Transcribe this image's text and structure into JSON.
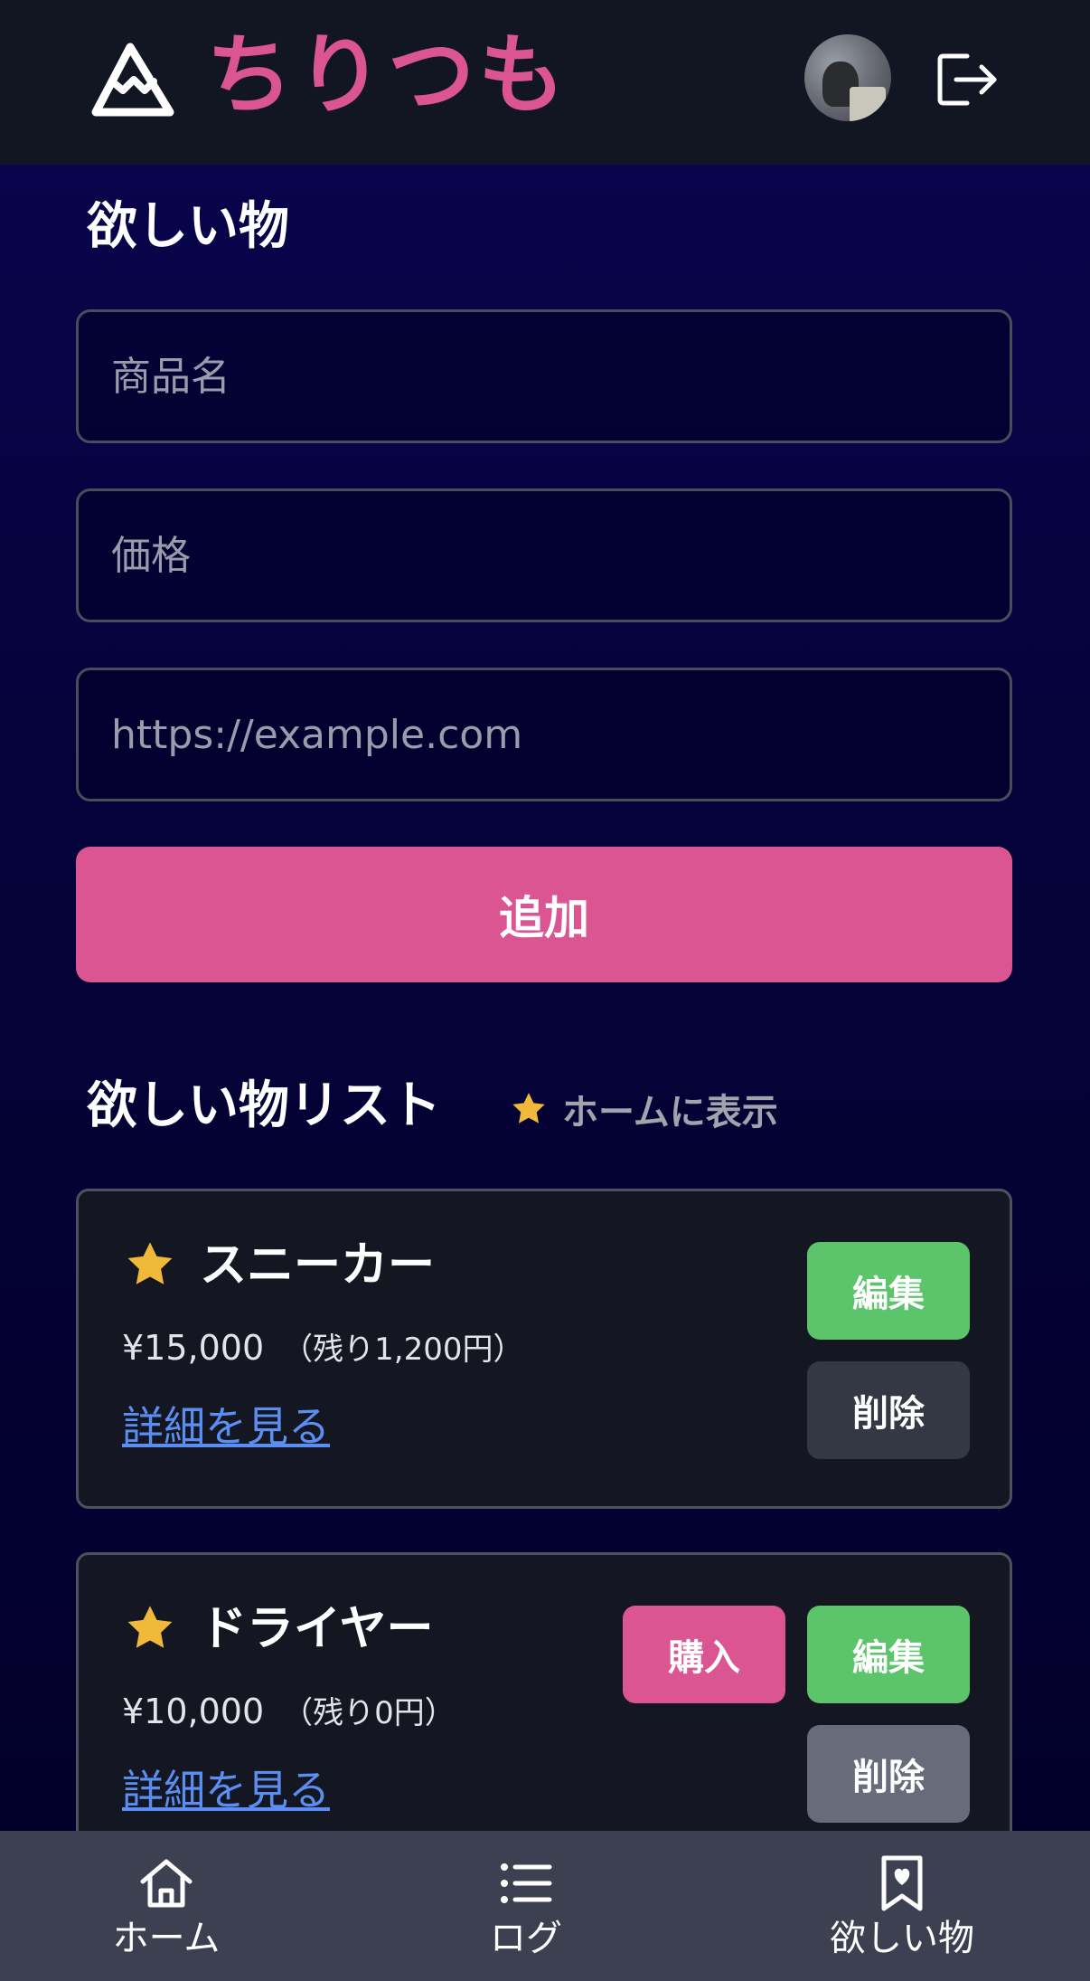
{
  "header": {
    "app_title": "ちりつも",
    "logo_icon": "mountain-icon",
    "avatar_icon": "user-avatar",
    "logout_icon": "logout-icon"
  },
  "form": {
    "title": "欲しい物",
    "name_placeholder": "商品名",
    "price_placeholder": "価格",
    "url_placeholder": "https://example.com",
    "add_label": "追加"
  },
  "list": {
    "title": "欲しい物リスト",
    "hint": "ホームに表示",
    "hint_icon": "star-icon",
    "items": [
      {
        "name": "スニーカー",
        "price": "¥15,000",
        "remaining": "（残り1,200円）",
        "link_label": "詳細を見る",
        "edit_label": "編集",
        "delete_label": "削除",
        "starred": true
      },
      {
        "name": "ドライヤー",
        "price": "¥10,000",
        "remaining": "（残り0円）",
        "link_label": "詳細を見る",
        "buy_label": "購入",
        "edit_label": "編集",
        "delete_label": "削除",
        "starred": true
      }
    ]
  },
  "bottom_nav": {
    "items": [
      {
        "label": "ホーム",
        "icon": "home-icon"
      },
      {
        "label": "ログ",
        "icon": "list-icon"
      },
      {
        "label": "欲しい物",
        "icon": "bookmark-heart-icon"
      }
    ]
  },
  "colors": {
    "accent": "#db5593",
    "edit": "#5cc46b",
    "star": "#f0b93a",
    "link": "#5b8ef2",
    "header_bg": "#121622",
    "nav_bg": "#3c4050"
  }
}
